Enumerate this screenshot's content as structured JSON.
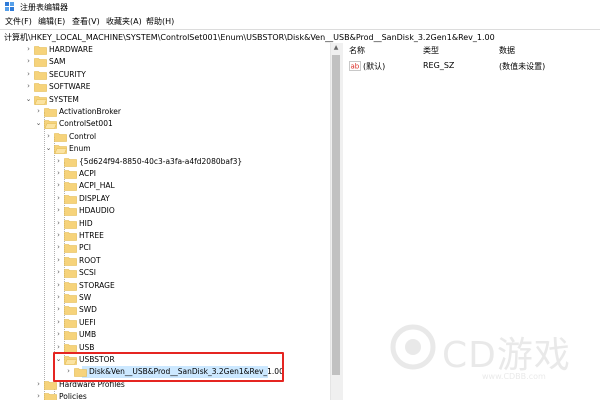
{
  "window": {
    "title": "注册表编辑器"
  },
  "menu": {
    "items": [
      "文件(F)",
      "编辑(E)",
      "查看(V)",
      "收藏夹(A)",
      "帮助(H)"
    ]
  },
  "address": {
    "path": "计算机\\HKEY_LOCAL_MACHINE\\SYSTEM\\ControlSet001\\Enum\\USBSTOR\\Disk&Ven__USB&Prod__SanDisk_3.2Gen1&Rev_1.00"
  },
  "tree": {
    "nodes": [
      {
        "label": "HARDWARE",
        "expanded": false
      },
      {
        "label": "SAM",
        "expanded": false
      },
      {
        "label": "SECURITY",
        "expanded": false
      },
      {
        "label": "SOFTWARE",
        "expanded": false
      },
      {
        "label": "SYSTEM",
        "expanded": true
      },
      {
        "label": "ActivationBroker",
        "expanded": false
      },
      {
        "label": "ControlSet001",
        "expanded": true
      },
      {
        "label": "Control",
        "expanded": false
      },
      {
        "label": "Enum",
        "expanded": true
      },
      {
        "label": "{5d624f94-8850-40c3-a3fa-a4fd2080baf3}",
        "expanded": false
      },
      {
        "label": "ACPI",
        "expanded": false
      },
      {
        "label": "ACPI_HAL",
        "expanded": false
      },
      {
        "label": "DISPLAY",
        "expanded": false
      },
      {
        "label": "HDAUDIO",
        "expanded": false
      },
      {
        "label": "HID",
        "expanded": false
      },
      {
        "label": "HTREE",
        "expanded": false
      },
      {
        "label": "PCI",
        "expanded": false
      },
      {
        "label": "ROOT",
        "expanded": false
      },
      {
        "label": "SCSI",
        "expanded": false
      },
      {
        "label": "STORAGE",
        "expanded": false
      },
      {
        "label": "SW",
        "expanded": false
      },
      {
        "label": "SWD",
        "expanded": false
      },
      {
        "label": "UEFI",
        "expanded": false
      },
      {
        "label": "UMB",
        "expanded": false
      },
      {
        "label": "USB",
        "expanded": false
      },
      {
        "label": "USBSTOR",
        "expanded": true
      },
      {
        "label": "Disk&Ven__USB&Prod__SanDisk_3.2Gen1&Rev_1.00",
        "expanded": false,
        "selected": true
      },
      {
        "label": "Hardware Profiles",
        "expanded": false
      },
      {
        "label": "Policies",
        "expanded": false
      }
    ]
  },
  "list": {
    "headers": {
      "name": "名称",
      "type": "类型",
      "data": "数据"
    },
    "rows": [
      {
        "icon": "string-value-icon",
        "name": "(默认)",
        "type": "REG_SZ",
        "data": "(数值未设置)"
      }
    ]
  },
  "watermark": {
    "text": "CD游戏",
    "sub": "www.CDBB.com"
  },
  "colors": {
    "highlight": "#e52521",
    "selection": "#cce8ff",
    "folder": "#f6d37b",
    "folder_dark": "#e2b84a"
  }
}
